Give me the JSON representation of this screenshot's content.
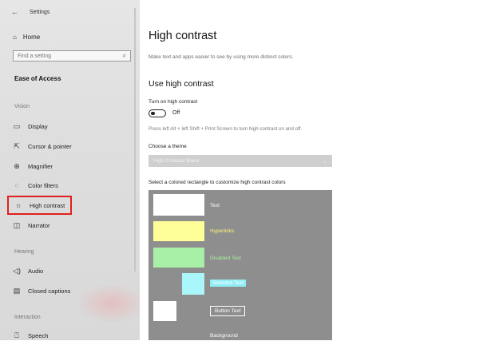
{
  "window": {
    "title": "Settings"
  },
  "sidebar": {
    "home": "Home",
    "search_placeholder": "Find a setting",
    "section": "Ease of Access",
    "groups": {
      "vision": "Vision",
      "hearing": "Hearing",
      "interaction": "Interaction"
    },
    "items": [
      {
        "label": "Display",
        "icon": "display-icon"
      },
      {
        "label": "Cursor & pointer",
        "icon": "cursor-icon"
      },
      {
        "label": "Magnifier",
        "icon": "magnifier-icon"
      },
      {
        "label": "Color filters",
        "icon": "color-filters-icon"
      },
      {
        "label": "High contrast",
        "icon": "brightness-icon",
        "active": true
      },
      {
        "label": "Narrator",
        "icon": "narrator-icon"
      },
      {
        "label": "Audio",
        "icon": "speaker-icon"
      },
      {
        "label": "Closed captions",
        "icon": "captions-icon"
      },
      {
        "label": "Speech",
        "icon": "microphone-icon"
      }
    ]
  },
  "main": {
    "title": "High contrast",
    "description": "Make text and apps easier to see by using more distinct colors.",
    "section_title": "Use high contrast",
    "toggle_label": "Turn on high contrast",
    "toggle_state": "Off",
    "hint": "Press left Alt + left Shift + Print Screen to turn high contrast on and off.",
    "theme_label": "Choose a theme",
    "theme_value": "High Contrast Black",
    "palette_label": "Select a colored rectangle to customize high contrast colors",
    "palette": {
      "text": "Text",
      "hyperlinks": "Hyperlinks",
      "disabled_text": "Disabled Text",
      "selected_text": "Selected Text",
      "button_text": "Button Text",
      "background": "Background"
    }
  },
  "colors": {
    "palette_bg": "#8e8e8e",
    "text_swatch": "#ffffff",
    "hyperlinks_swatch": "#ffff9a",
    "disabled_swatch": "#a8f0a8",
    "selected_swatch": "#a9f6fb",
    "button_swatch": "#ffffff",
    "highlight_outline": "#e02020"
  }
}
